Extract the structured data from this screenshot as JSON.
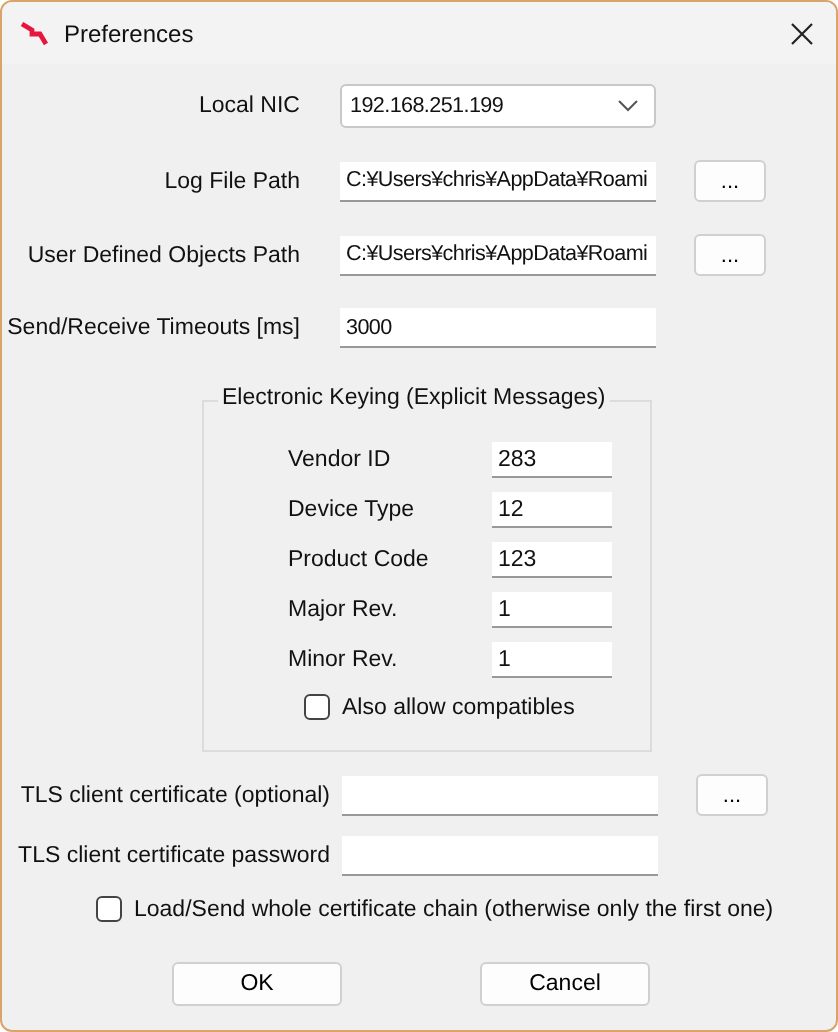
{
  "window": {
    "title": "Preferences"
  },
  "settings": [
    {
      "label": "Local NIC",
      "kind": "dropdown",
      "value": "192.168.251.199"
    },
    {
      "label": "Log File Path",
      "kind": "text",
      "value": "C:¥Users¥chris¥AppData¥Roami",
      "browse_label": "..."
    },
    {
      "label": "User Defined Objects Path",
      "kind": "text",
      "value": "C:¥Users¥chris¥AppData¥Roami",
      "browse_label": "..."
    },
    {
      "label": "Send/Receive Timeouts [ms]",
      "kind": "text",
      "value": "3000"
    }
  ],
  "keying": {
    "title": "Electronic Keying (Explicit Messages)",
    "fields": [
      {
        "label": "Vendor ID",
        "value": "283"
      },
      {
        "label": "Device Type",
        "value": "12"
      },
      {
        "label": "Product Code",
        "value": "123"
      },
      {
        "label": "Major Rev.",
        "value": "1"
      },
      {
        "label": "Minor Rev.",
        "value": "1"
      }
    ],
    "checkbox": {
      "label": "Also allow compatibles",
      "checked": false
    }
  },
  "tls": [
    {
      "label": "TLS client certificate (optional)",
      "browse_label": "..."
    },
    {
      "label": "TLS client certificate password"
    }
  ],
  "chain_checkbox": {
    "label": "Load/Send whole certificate chain (otherwise only the first one)",
    "checked": false
  },
  "buttons": [
    "OK",
    "Cancel"
  ]
}
